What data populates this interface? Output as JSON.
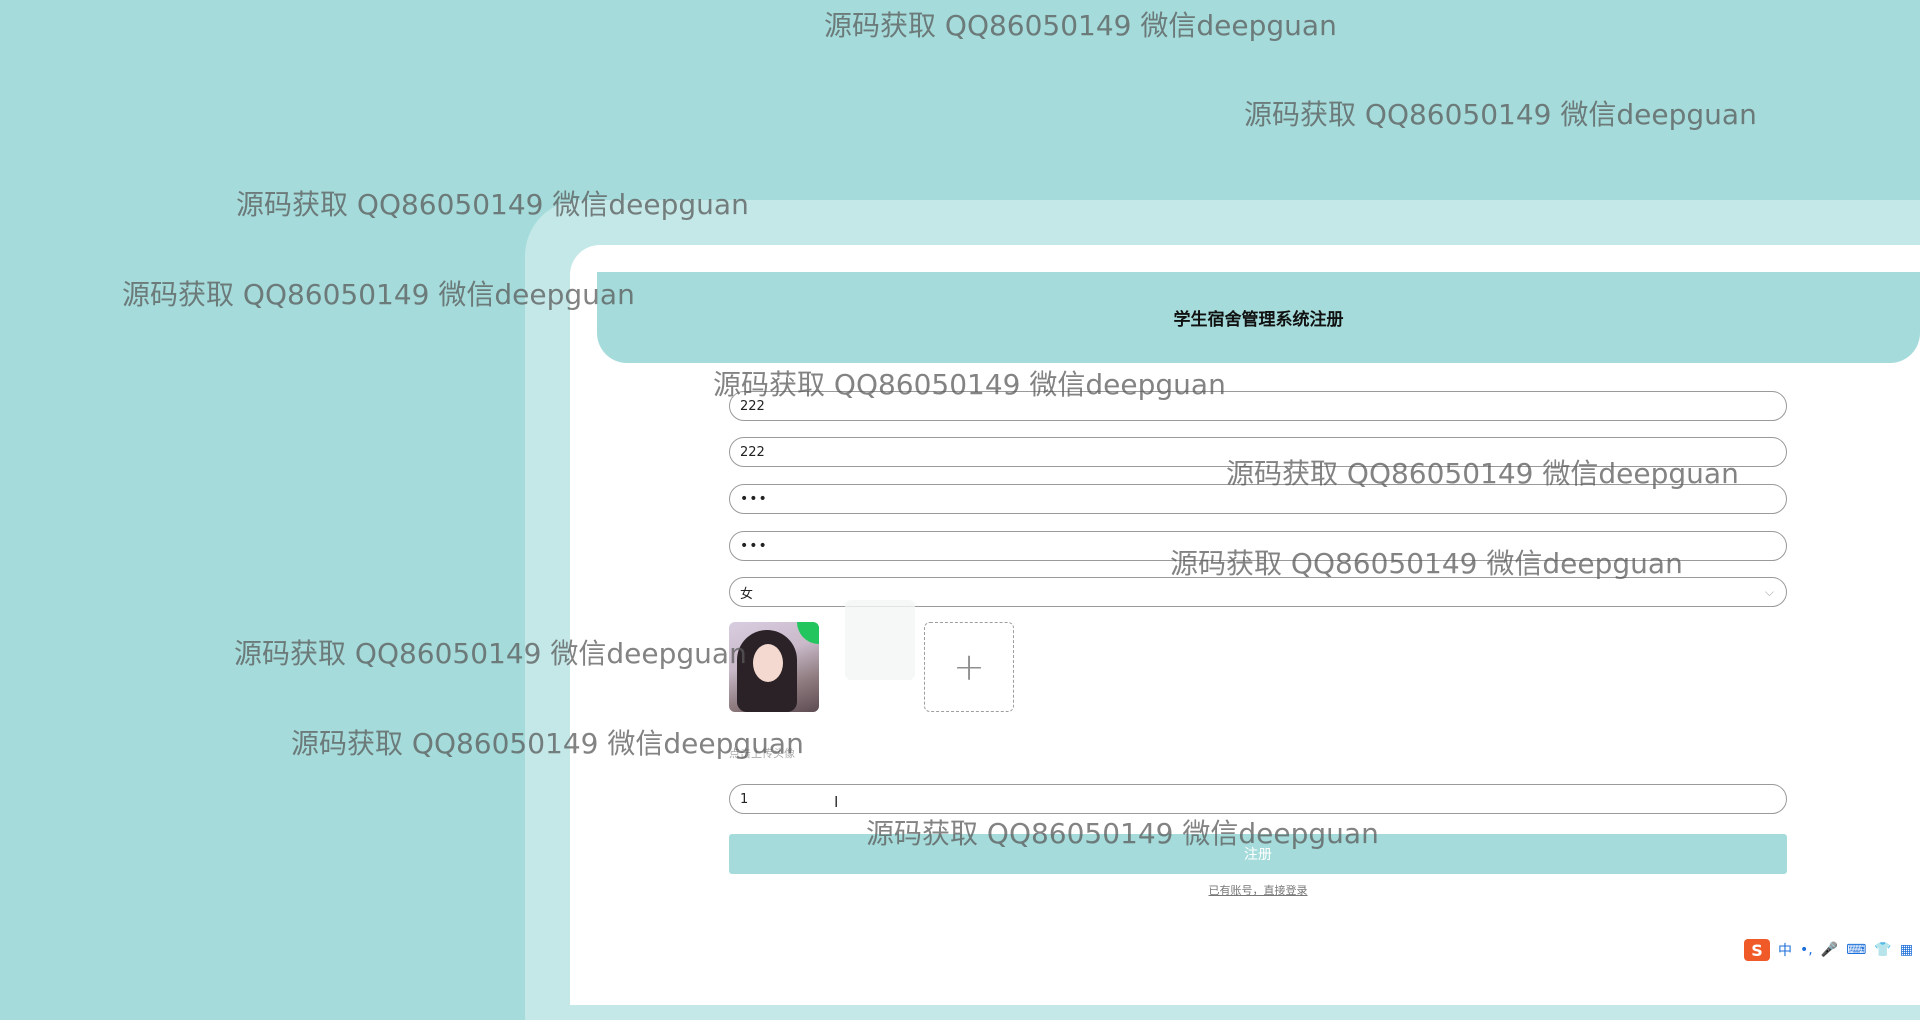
{
  "form": {
    "title": "学生宿舍管理系统注册",
    "account_value": "222",
    "name_value": "222",
    "password_value": "•••",
    "confirm_password_value": "•••",
    "gender_value": "女",
    "upload_plus": "+",
    "upload_hint": "点击上传头像",
    "extra_value": "1",
    "submit_label": "注册",
    "login_link": "已有账号，直接登录"
  },
  "watermark": "源码获取 QQ86050149 微信deepguan",
  "tray": {
    "ime_logo": "S",
    "ime_mode": "中",
    "punct": "•,",
    "mic_icon": "🎤",
    "keyboard_icon": "⌨",
    "skin_icon": "👕",
    "grid_icon": "▦"
  },
  "colors": {
    "background": "#a5dcdb",
    "frame": "#c3e8e7",
    "panel": "#ffffff"
  }
}
